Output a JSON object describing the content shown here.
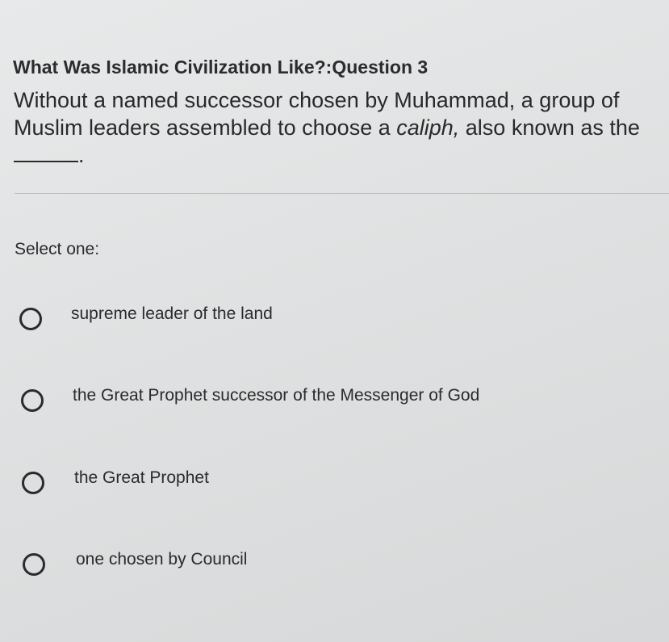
{
  "quiz": {
    "title": "What Was Islamic Civilization Like?:Question 3",
    "question": {
      "text_before": "Without a named successor chosen by Muhammad, a group of Muslim leaders assembled to choose a ",
      "emphasis": "caliph,",
      "text_after": " also known as the",
      "end": "."
    },
    "select_label": "Select one:",
    "options": [
      {
        "label": "supreme leader of the land",
        "selected": false
      },
      {
        "label": "the Great Prophet successor of the Messenger of God",
        "selected": false
      },
      {
        "label": "the Great Prophet",
        "selected": false
      },
      {
        "label": "one chosen by Council",
        "selected": false
      }
    ]
  }
}
